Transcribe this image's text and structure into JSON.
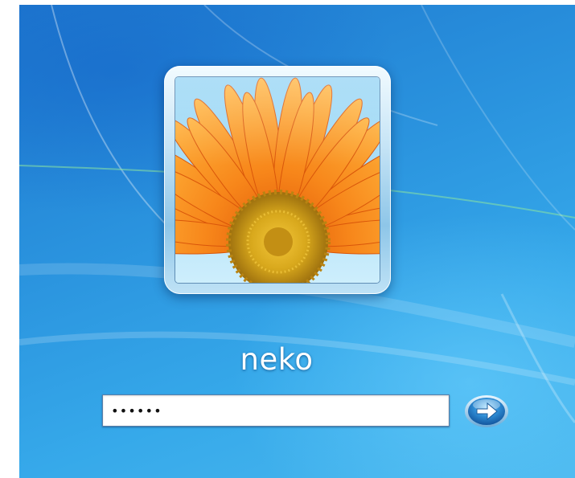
{
  "login": {
    "username": "neko",
    "password_masked": "••••••"
  },
  "icons": {
    "avatar": "orange-daisy-picture",
    "submit": "arrow-right-icon"
  },
  "colors": {
    "background": "#2a93de",
    "avatar_frame": "#bfe2f6",
    "flower_petal": "#f7861a",
    "flower_center": "#d8a81c",
    "submit_button": "#2f8ed6"
  }
}
